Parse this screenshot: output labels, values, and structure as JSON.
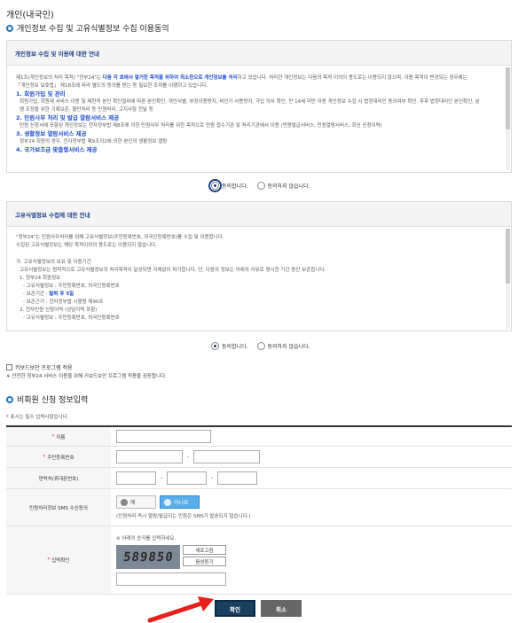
{
  "page_title": "개인(내국인)",
  "section1_title": "개인정보 수집 및 고유식별정보 수집 이용동의",
  "panel1": {
    "header": "개인정보 수집 및 이용에 대한 안내",
    "intro_a": "제1조(개인정보의 처리 목적) \"정부24\"는 ",
    "intro_bold": "다음 각 호에서 열거한 목적을 위하여 최소한으로 개인정보를 처리",
    "intro_b": "하고 있습니다. 처리한 개인정보는 다음의 목적 이외의 용도로는 이용되지 않으며, 이용 목적이 변경되는 경우에는",
    "intro_c": "「개인정보 보호법」 제18조에 따라 별도의 동의를 받는 등 필요한 조치를 이행하고 있습니다.",
    "h1": "1. 회원가입 및 관리",
    "p1a": "회원가입, 회원제 서비스 이용 및 제한적 본인 확인절차에 따른 본인확인, 개인식별, 부정이용방지, 비인가 사용방지, 가입 의사 확인, 만 14세 미만 아동 개인정보 수집 시 법정대리인 동의여부 확인, 추후 법정대리인 본인확인, 분",
    "p1b": "쟁 조정을 위한 기록보존, 불만처리 등 민원처리, 고지사항 전달 등",
    "h2": "2. 민원사무 처리 및 발급 열람서비스 제공",
    "p2": "민원 신청서에 포함된 개인정보는 전자정부법 제8조에 의한 민원사무 처리를 위한 목적으로 민원 접수기관 및 처리기관에서 이용 (민원발급서비스, 민원열람서비스, 회신 신청이력)",
    "h3": "3. 생활정보 열람서비스 제공",
    "p3": "정부24 회원의 경우, 전자정부법 제9조의2에 의한 본인의 생활정보 열람",
    "h4": "4. 국가보조금 맞춤형서비스 제공"
  },
  "consent1": {
    "agree": "동의합니다.",
    "disagree": "동의하지 않습니다."
  },
  "panel2": {
    "header": "고유식별정보 수집에 대한 안내",
    "l1": "\"정부24\"는 민원사무처리를 위해 고유식별정보(주민등록번호, 외국인등록번호)를 수집 및 이용합니다.",
    "l2": "수집된 고유식별정보는 해당 목적이외의 용도로는 이용되지 않습니다.",
    "l3": "가. 고유식별정보의 보유 및 이용기간",
    "l4": "고유식별정보는 원칙적으로 고유식별정보의 처리목적이 달성되면 지체없이 파기합니다. 단, 다음의 정보는 아래의 사유로 명시한 기간 동안 보존합니다.",
    "l5": "1. 정부24 회원정보",
    "l6": "- 고유식별정보 : 주민등록번호, 외국인등록번호",
    "l7a": "- 보존기간 : ",
    "l7b": "탈퇴 후 5일",
    "l8": "- 보존근거 : 전자정부법 시행령 제90조",
    "l9": "2. 전자민원 신청이력 (상담이력 포함)",
    "l10": "- 고유식별정보 : 주민등록번호, 외국인등록번호"
  },
  "consent2": {
    "agree": "동의합니다.",
    "disagree": "동의하지 않습니다."
  },
  "keyboard_security": {
    "label": "키보드보안 프로그램 적용",
    "note": "※ 안전한 정부24 서비스 이용을 위해 키보드보안 프로그램 적용을 권장합니다."
  },
  "section2_title": "비회원 신청 정보입력",
  "required_note": "표시는 필수 입력사항입니다.",
  "form": {
    "name_label": "이름",
    "rrn_label": "주민등록번호",
    "phone_label": "연락처(휴대폰번호)",
    "sms_label": "민원처리정보 SMS 수신동의",
    "sms_yes": "예",
    "sms_no": "아니요",
    "sms_note": "(민원처리 즉시 열람/발급되는 민원은 SMS가 발송되지 않습니다.)",
    "captcha_label": "입력확인",
    "captcha_note": "※ 아래의 숫자를 입력하세요.",
    "captcha_value": "589850",
    "refresh_btn": "새로고침",
    "audio_btn": "음성듣기"
  },
  "buttons": {
    "confirm": "확인",
    "cancel": "취소"
  },
  "colors": {
    "primary": "#1b3f8a",
    "accent_blue": "#1e4fd0",
    "sms_selected": "#5aaee8",
    "cancel": "#666666",
    "arrow": "#e8201c"
  }
}
